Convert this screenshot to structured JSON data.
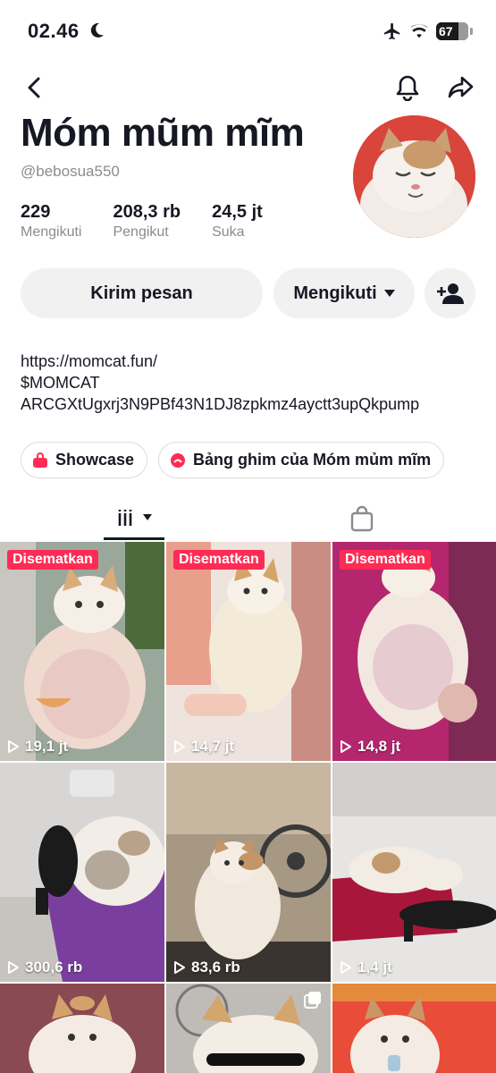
{
  "status_bar": {
    "time": "02.46",
    "battery": "67"
  },
  "profile": {
    "display_name": "Móm mũm mĩm",
    "handle": "@bebosua550",
    "stats": [
      {
        "value": "229",
        "label": "Mengikuti"
      },
      {
        "value": "208,3 rb",
        "label": "Pengikut"
      },
      {
        "value": "24,5 jt",
        "label": "Suka"
      }
    ],
    "bio_lines": [
      "https://momcat.fun/",
      "$MOMCAT",
      "ARCGXtUgxrj3N9PBf43N1DJ8zpkmz4ayctt3upQkpump"
    ]
  },
  "actions": {
    "message_label": "Kirim pesan",
    "following_label": "Mengikuti"
  },
  "chips": [
    {
      "label": "Showcase",
      "icon": "bag-icon"
    },
    {
      "label": "Bảng ghim của Móm mủm mĩm",
      "icon": "pin-board-icon"
    }
  ],
  "videos": [
    {
      "pinned": "Disematkan",
      "views": "19,1 jt"
    },
    {
      "pinned": "Disematkan",
      "views": "14,7 jt"
    },
    {
      "pinned": "Disematkan",
      "views": "14,8 jt"
    },
    {
      "pinned": "",
      "views": "300,6 rb"
    },
    {
      "pinned": "",
      "views": "83,6 rb"
    },
    {
      "pinned": "",
      "views": "1,4 jt"
    },
    {
      "pinned": "",
      "views": ""
    },
    {
      "pinned": "",
      "views": ""
    },
    {
      "pinned": "",
      "views": ""
    }
  ],
  "colors": {
    "accent": "#fe2c55",
    "text": "#161823",
    "muted": "#8a8b91",
    "button_bg": "#f1f1f2"
  }
}
